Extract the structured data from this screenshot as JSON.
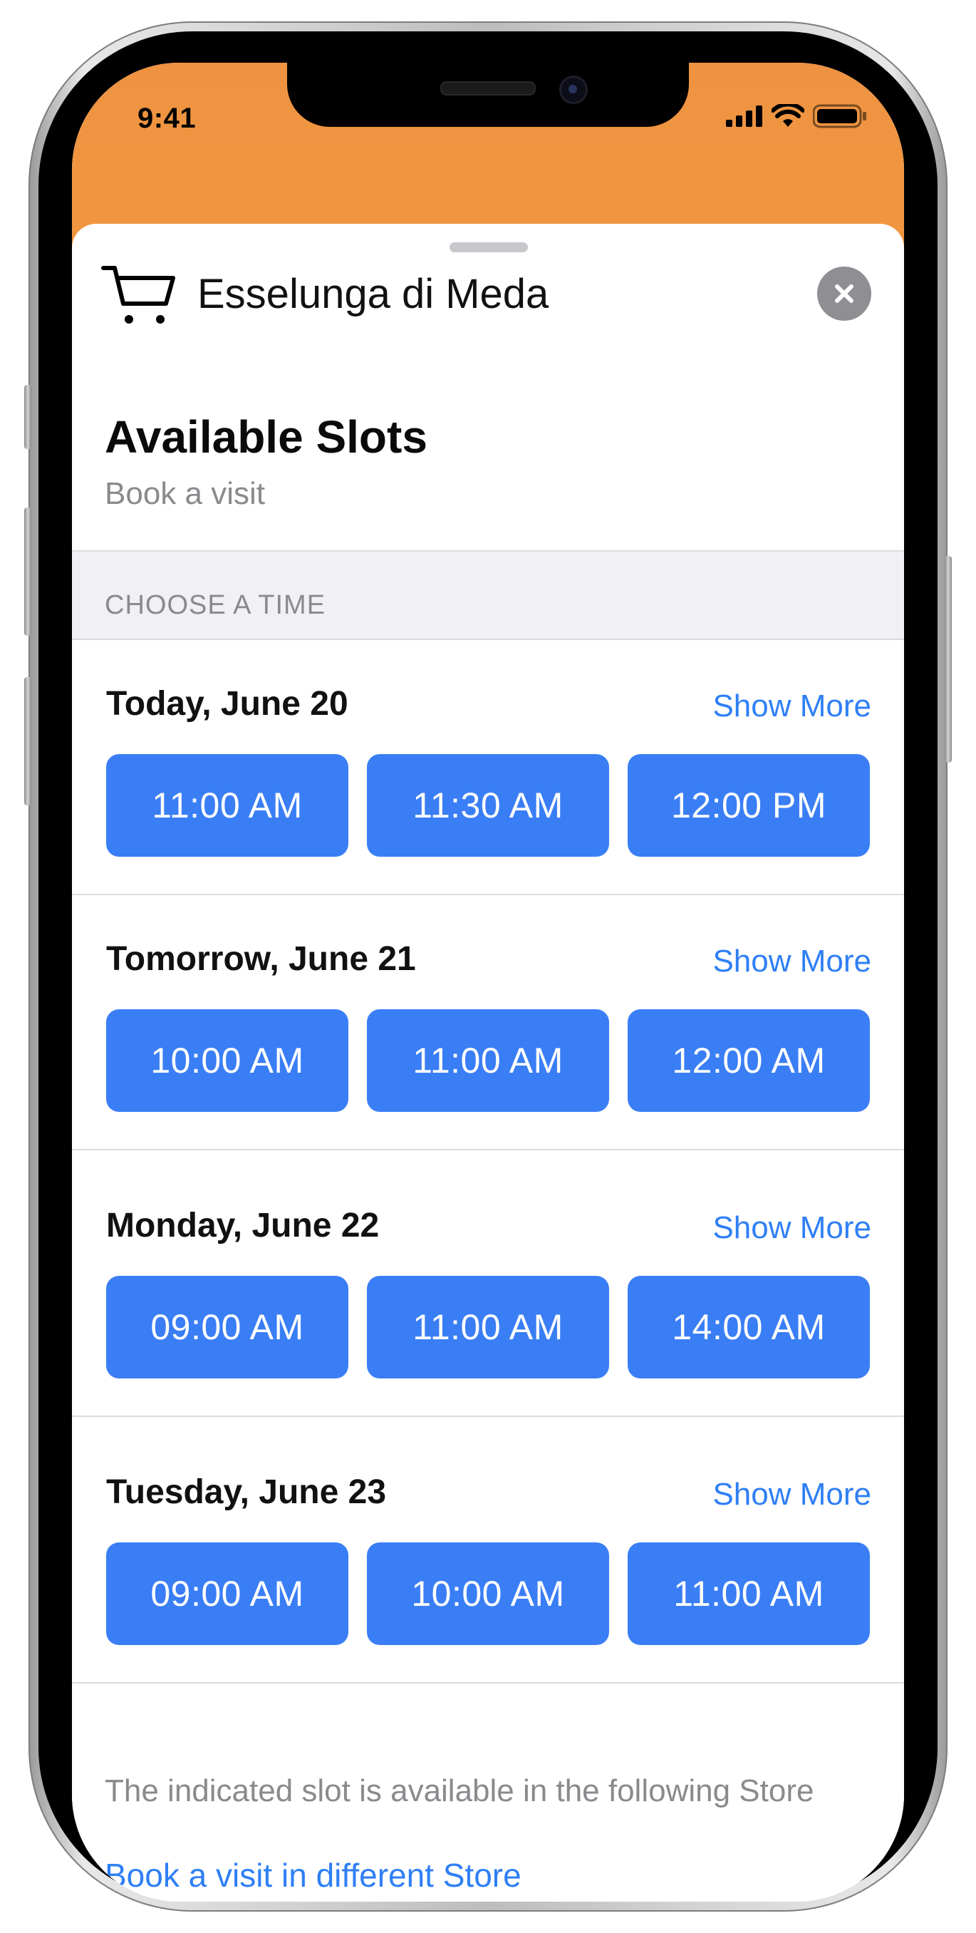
{
  "status_bar": {
    "time": "9:41"
  },
  "store": {
    "name": "Esselunga di Meda",
    "icon": "cart-icon"
  },
  "header": {
    "title": "Available Slots",
    "subtitle": "Book a visit"
  },
  "section": {
    "label": "CHOOSE A TIME"
  },
  "days": [
    {
      "label": "Today, June 20",
      "show_more": "Show More",
      "slots": [
        "11:00 AM",
        "11:30 AM",
        "12:00 PM"
      ]
    },
    {
      "label": "Tomorrow, June 21",
      "show_more": "Show More",
      "slots": [
        "10:00 AM",
        "11:00 AM",
        "12:00 AM"
      ]
    },
    {
      "label": "Monday, June 22",
      "show_more": "Show More",
      "slots": [
        "09:00 AM",
        "11:00 AM",
        "14:00 AM"
      ]
    },
    {
      "label": "Tuesday, June 23",
      "show_more": "Show More",
      "slots": [
        "09:00 AM",
        "10:00 AM",
        "11:00 AM"
      ]
    }
  ],
  "footer": {
    "note": "The indicated slot is available in the following Store",
    "link": "Book a visit in different Store"
  },
  "colors": {
    "accent": "#3a7ef5",
    "link": "#2f7ff5",
    "header_bg": "#f0963f"
  }
}
